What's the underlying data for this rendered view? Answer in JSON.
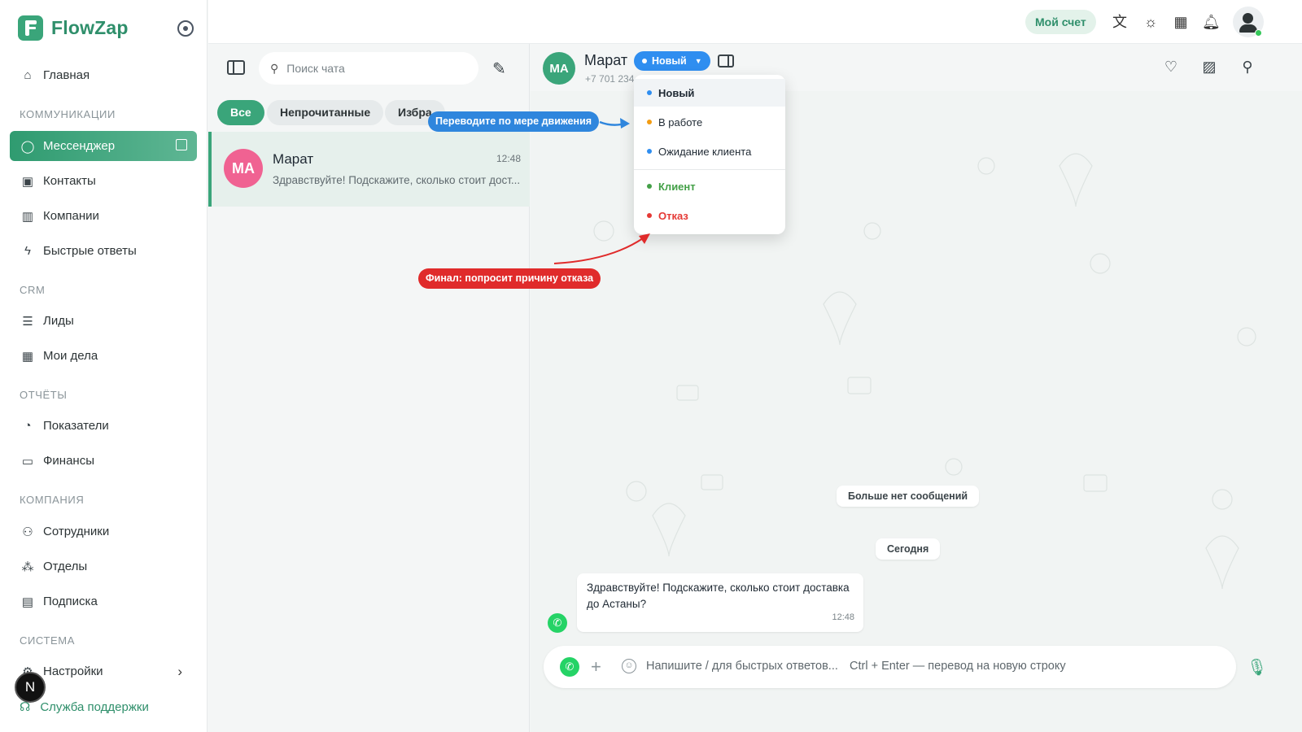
{
  "app": {
    "name": "FlowZap"
  },
  "sidebar": {
    "items": [
      {
        "label": "Главная",
        "icon": "home-icon"
      },
      {
        "label": "Мессенджер",
        "icon": "chat-icon"
      },
      {
        "label": "Контакты",
        "icon": "contacts-icon"
      },
      {
        "label": "Компании",
        "icon": "building-icon"
      },
      {
        "label": "Быстрые ответы",
        "icon": "bolt-icon"
      },
      {
        "label": "Лиды",
        "icon": "funnel-icon"
      },
      {
        "label": "Мои дела",
        "icon": "calendar-icon"
      },
      {
        "label": "Показатели",
        "icon": "pie-chart-icon"
      },
      {
        "label": "Финансы",
        "icon": "cash-icon"
      },
      {
        "label": "Сотрудники",
        "icon": "users-icon"
      },
      {
        "label": "Отделы",
        "icon": "org-icon"
      },
      {
        "label": "Подписка",
        "icon": "wallet-icon"
      },
      {
        "label": "Настройки",
        "icon": "gear-icon"
      }
    ],
    "sections": {
      "communications": "КОММУНИКАЦИИ",
      "crm": "CRM",
      "reports": "ОТЧЁТЫ",
      "company": "КОМПАНИЯ",
      "system": "СИСТЕМА"
    },
    "user_initial": "N",
    "support_label": "Служба поддержки"
  },
  "topbar": {
    "account_label": "Мой счет",
    "icons": [
      "translate-icon",
      "sun-icon",
      "apps-icon",
      "bell-icon",
      "user-icon"
    ]
  },
  "chatlist": {
    "search_placeholder": "Поиск чата",
    "filters": [
      "Все",
      "Непрочитанные",
      "Избра"
    ],
    "chats": [
      {
        "initials": "МА",
        "name": "Марат",
        "time": "12:48",
        "preview": "Здравствуйте! Подскажите, сколько стоит дост..."
      }
    ]
  },
  "conversation": {
    "initials": "МА",
    "name": "Марат",
    "phone": "+7 701 234",
    "status": "Новый",
    "status_options": [
      {
        "label": "Новый",
        "color": "#2f8ef0",
        "text_color": "#1f2933"
      },
      {
        "label": "В работе",
        "color": "#f39c12",
        "text_color": "#1f2933"
      },
      {
        "label": "Ожидание клиента",
        "color": "#2f8ef0",
        "text_color": "#1f2933"
      },
      {
        "label": "Клиент",
        "color": "#43a047",
        "text_color": "#43a047"
      },
      {
        "label": "Отказ",
        "color": "#e53935",
        "text_color": "#e53935"
      }
    ],
    "callouts": {
      "blue": "Переводите по мере движения",
      "red": "Финал: попросит причину отказа"
    },
    "no_more": "Больше нет сообщений",
    "today": "Сегодня",
    "messages": [
      {
        "text": "Здравствуйте! Подскажите, сколько стоит доставка до Астаны?",
        "time": "12:48"
      }
    ],
    "composer_placeholder": "Напишите / для быстрых ответов...",
    "composer_hint": "Ctrl + Enter — перевод на новую строку"
  },
  "colors": {
    "brand": "#3aa57a",
    "status_blue": "#2f8ef0",
    "callout_red": "#e02b2b"
  }
}
